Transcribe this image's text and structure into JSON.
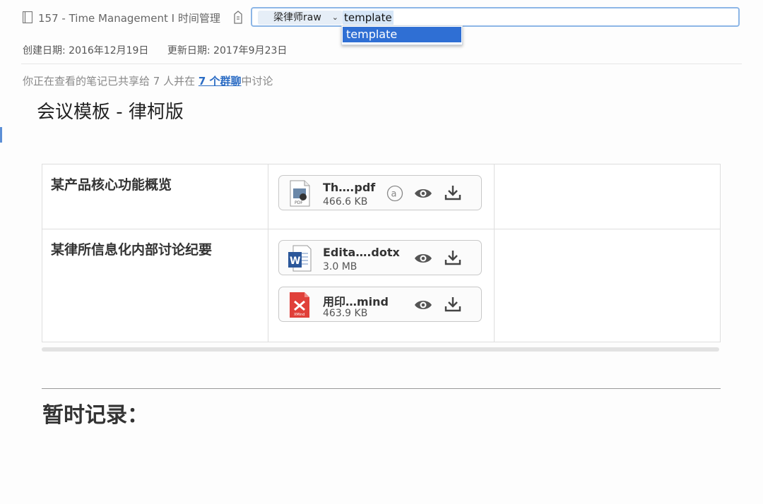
{
  "header": {
    "notebook_title": "157 - Time Management I 时间管理",
    "tag_chip": "梁律师raw",
    "tag_input": "template",
    "suggestion": "template"
  },
  "meta": {
    "created": "创建日期: 2016年12月19日",
    "updated": "更新日期: 2017年9月23日"
  },
  "share": {
    "prefix": "你正在查看的笔记已共享给 7 人并在 ",
    "link": "7 个群聊",
    "suffix": "中讨论"
  },
  "document": {
    "title": "会议模板 - 律柯版",
    "section_heading": "暂时记录："
  },
  "table": {
    "rows": [
      {
        "label": "某产品核心功能概览",
        "attachments": [
          {
            "name": "Th….pdf",
            "size": "466.6 KB",
            "icon": "pdf-file-icon"
          }
        ]
      },
      {
        "label": "某律所信息化内部讨论纪要",
        "attachments": [
          {
            "name": "Edita….dotx",
            "size": "3.0 MB",
            "icon": "word-file-icon"
          },
          {
            "name": "用印…mind",
            "size": "463.9 KB",
            "icon": "xmind-file-icon"
          }
        ]
      }
    ]
  },
  "colors": {
    "link": "#2b6cc4",
    "suggestion_highlight": "#2f6fd4",
    "tagbox_focus": "#8db6e6",
    "word_blue": "#2b579a",
    "xmind_red": "#e0403a"
  }
}
